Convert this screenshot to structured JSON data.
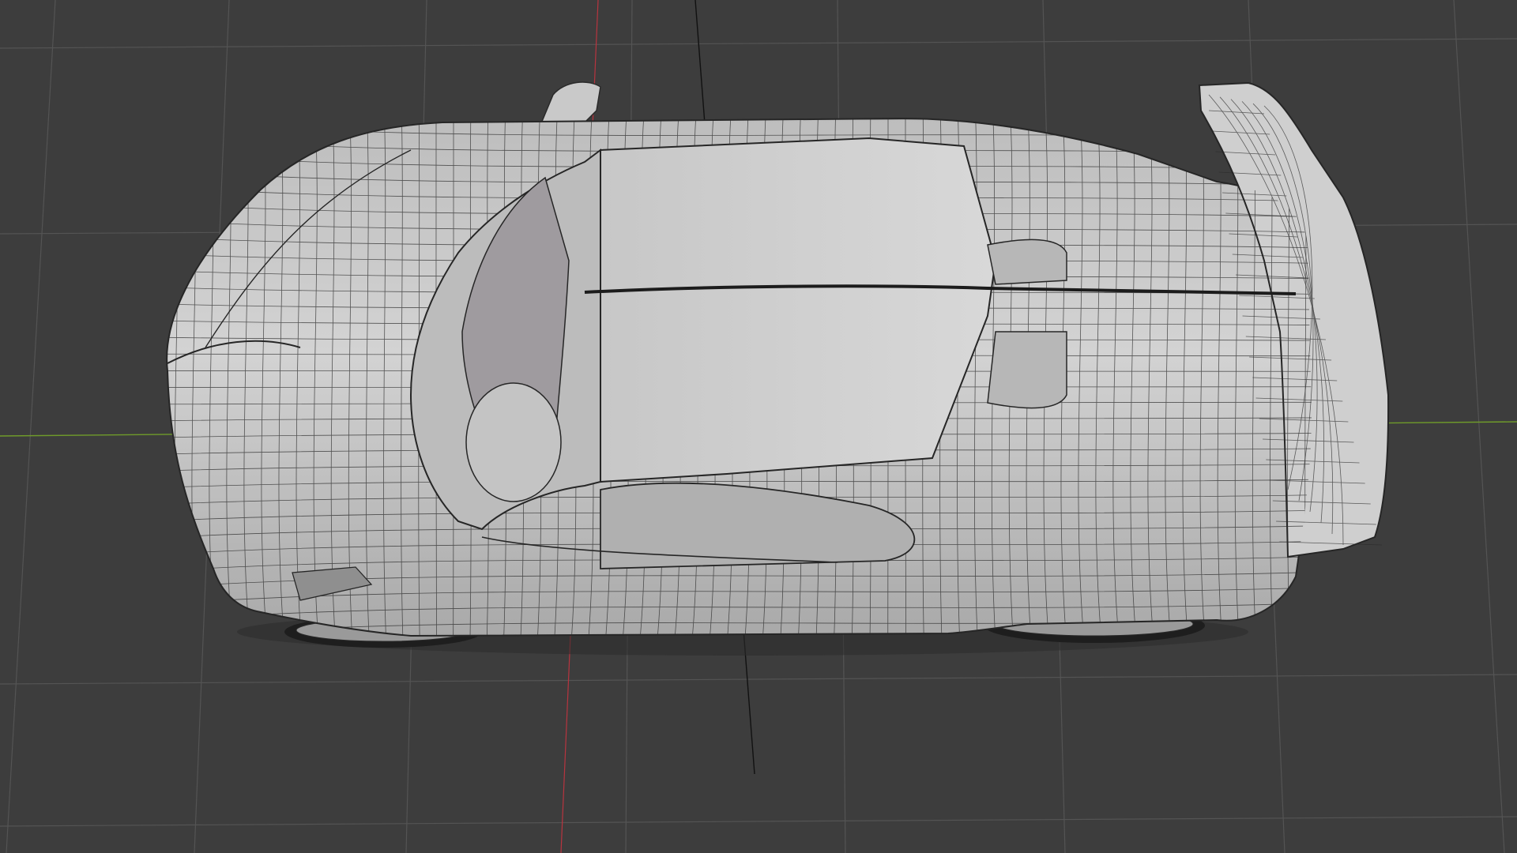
{
  "viewport": {
    "view": "top",
    "shading": "solid",
    "wireframe_overlay": true,
    "background_color": "#3d3d3d",
    "grid_color": "#545454",
    "x_axis_color": "#b8343f",
    "y_axis_color": "#6f9b2a",
    "z_axis_color": "#111111",
    "mesh_color": "#cfcfcf",
    "wire_color": "#2a2a2a"
  },
  "object": {
    "type": "car-mesh",
    "selected": false
  }
}
